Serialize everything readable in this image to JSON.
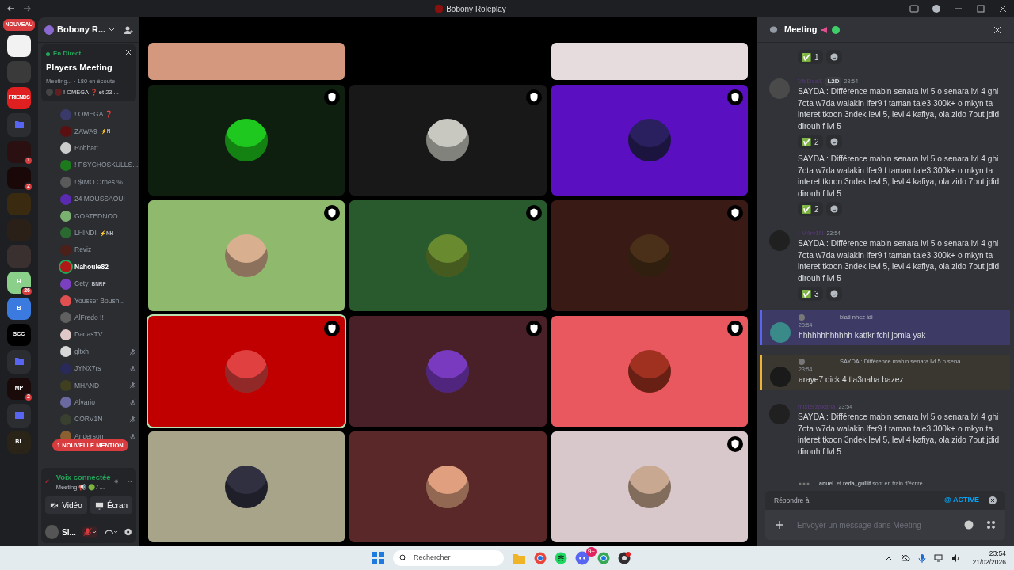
{
  "window": {
    "title": "Bobony Roleplay"
  },
  "servers": [
    {
      "kind": "new",
      "label": "NOUVEAU",
      "color": "#d83c3e"
    },
    {
      "kind": "icon",
      "color": "#f2f2f2"
    },
    {
      "kind": "icon",
      "color": "#3a3a3a"
    },
    {
      "kind": "icon",
      "color": "#e02020",
      "label": "FRIENDS"
    },
    {
      "kind": "folder",
      "color": "#5865f2"
    },
    {
      "kind": "icon",
      "color": "#2a1010",
      "badge": "1"
    },
    {
      "kind": "icon",
      "color": "#1a0808",
      "badge": "2"
    },
    {
      "kind": "icon",
      "color": "#3a2a10"
    },
    {
      "kind": "icon",
      "color": "#2a2018"
    },
    {
      "kind": "icon",
      "color": "#3a3030"
    },
    {
      "kind": "icon",
      "color": "#8ad08a",
      "label": "H",
      "badge": "26"
    },
    {
      "kind": "icon",
      "color": "#3b7be0",
      "label": "B"
    },
    {
      "kind": "icon",
      "color": "#000000",
      "label": "SCC"
    },
    {
      "kind": "folder",
      "color": "#5865f2"
    },
    {
      "kind": "icon",
      "color": "#1a0a0a",
      "label": "MP",
      "badge": "2"
    },
    {
      "kind": "folder",
      "color": "#5865f2"
    },
    {
      "kind": "icon",
      "color": "#2a2418",
      "label": "BL"
    }
  ],
  "server": {
    "name": "Bobony R..."
  },
  "live": {
    "status": "En Direct",
    "title": "Players Meeting",
    "info": "Meeting... · 180 en écoute",
    "participants": "! OMEGA ❓ et 23 ..."
  },
  "members": [
    {
      "name": "! OMEGA ❓",
      "color": "#3a3a6a",
      "muted": false,
      "speaking": false
    },
    {
      "name": "ZAWA9",
      "tag": "⚡N",
      "color": "#5a1010",
      "muted": false,
      "speaking": false
    },
    {
      "name": "Robbatt",
      "color": "#cccccc",
      "muted": false,
      "speaking": false
    },
    {
      "name": "! PSYCHOSKULLS...",
      "color": "#1c7a1c",
      "muted": false,
      "speaking": false
    },
    {
      "name": "! $IMO Ornes %",
      "color": "#5a5a5a",
      "muted": false,
      "speaking": false
    },
    {
      "name": "24 MOUSSAOUI",
      "color": "#5a2ab0",
      "muted": false,
      "speaking": false
    },
    {
      "name": "GOATEDNOO...",
      "color": "#7ab070",
      "muted": false,
      "speaking": false
    },
    {
      "name": "LHINDI",
      "tag": "⚡NH",
      "color": "#2a6a30",
      "muted": false,
      "speaking": false
    },
    {
      "name": "Reviz",
      "color": "#4a2018",
      "muted": false,
      "speaking": false
    },
    {
      "name": "Nahoule82",
      "color": "#b01818",
      "muted": false,
      "speaking": true
    },
    {
      "name": "Cety",
      "tag": "BNRP",
      "color": "#7a40c0",
      "muted": false,
      "speaking": false
    },
    {
      "name": "Youssef Boush...",
      "color": "#e05050",
      "muted": false,
      "speaking": false
    },
    {
      "name": "AlFredo !!",
      "color": "#606060",
      "muted": false,
      "speaking": false
    },
    {
      "name": "DanasTV",
      "color": "#e0c8c8",
      "muted": false,
      "speaking": false
    },
    {
      "name": "gltxh",
      "color": "#d8d8d8",
      "muted": true,
      "speaking": false
    },
    {
      "name": "JYNX7rs",
      "color": "#2a2a5a",
      "muted": true,
      "speaking": false
    },
    {
      "name": "MHAND",
      "color": "#404020",
      "muted": true,
      "speaking": false
    },
    {
      "name": "Alvario",
      "color": "#6a6aa0",
      "muted": true,
      "speaking": false
    },
    {
      "name": "CORV1N",
      "color": "#3a4030",
      "muted": true,
      "speaking": false
    },
    {
      "name": "Anderson",
      "color": "#8a6030",
      "muted": true,
      "speaking": false
    }
  ],
  "mention_pill": "1 NOUVELLE MENTION",
  "voice": {
    "status": "Voix connectée",
    "channel": "Meeting 📢 🟢 / ...",
    "video": "Vidéo",
    "screen": "Écran"
  },
  "user": {
    "name": "Sl...",
    "mic_muted": true
  },
  "tiles": [
    {
      "kind": "partial",
      "color": "#d4987f"
    },
    {
      "kind": "empty"
    },
    {
      "kind": "partial",
      "color": "#e6dcde"
    },
    {
      "kind": "participant",
      "color": "#0e1f10",
      "speaking": false,
      "badge": true
    },
    {
      "kind": "participant",
      "color": "#181818",
      "speaking": false,
      "badge": true
    },
    {
      "kind": "participant",
      "color": "#5a0fc0",
      "speaking": false,
      "badge": true
    },
    {
      "kind": "participant",
      "color": "#8fba6e",
      "speaking": false,
      "badge": true
    },
    {
      "kind": "participant",
      "color": "#285a2e",
      "speaking": false,
      "badge": true
    },
    {
      "kind": "participant",
      "color": "#3a1a14",
      "speaking": false,
      "badge": true
    },
    {
      "kind": "participant",
      "color": "#c00000",
      "speaking": true,
      "badge": true
    },
    {
      "kind": "participant",
      "color": "#4a2028",
      "speaking": false,
      "badge": true
    },
    {
      "kind": "participant",
      "color": "#e8585e",
      "speaking": false,
      "badge": true
    },
    {
      "kind": "participant",
      "color": "#a8a48a",
      "speaking": false,
      "badge": false
    },
    {
      "kind": "participant",
      "color": "#5a2828",
      "speaking": false,
      "badge": false
    },
    {
      "kind": "participant",
      "color": "#d8c8cc",
      "speaking": false,
      "badge": true
    }
  ],
  "chat": {
    "title": "Meeting",
    "messages": [
      {
        "kind": "continuation",
        "reactions": [
          {
            "emoji": "✅",
            "count": "1"
          }
        ]
      },
      {
        "kind": "message",
        "author": "VibDoaX",
        "tag": "L2D",
        "time": "23:54",
        "text": "SAYDA : Différence mabin senara lvl 5 o senara lvl 4 ghi 7ota w7da walakin lfer9 f taman tale3 300k+ o mkyn ta interet tkoon 3ndek levl 5, levl 4 kafiya, ola zido 7out jdid dirouh f lvl 5",
        "reactions": [
          {
            "emoji": "✅",
            "count": "2"
          }
        ]
      },
      {
        "kind": "continuation",
        "text": "SAYDA : Différence mabin senara lvl 5 o senara lvl 4 ghi 7ota w7da walakin lfer9 f taman tale3 300k+ o mkyn ta interet tkoon 3ndek levl 5, levl 4 kafiya, ola zido 7out jdid dirouh f lvl 5",
        "reactions": [
          {
            "emoji": "✅",
            "count": "2"
          }
        ]
      },
      {
        "kind": "message",
        "author": "! M4rv1N",
        "time": "23:54",
        "text": "SAYDA : Différence mabin senara lvl 5 o senara lvl 4 ghi 7ota w7da walakin lfer9 f taman tale3 300k+ o mkyn ta interet tkoon 3ndek levl 5, levl 4 kafiya, ola zido 7out jdid dirouh f lvl 5",
        "reactions": [
          {
            "emoji": "✅",
            "count": "3"
          }
        ]
      },
      {
        "kind": "reply",
        "mentions_me": false,
        "reply_text": "blati nhez idi",
        "time": "23:54",
        "text": "hhhhhhhhhhhh katfkr fchi jomla yak"
      },
      {
        "kind": "reply",
        "mentions_me": true,
        "reply_text": "SAYDA : Différence mabin senara lvl 5 o sena...",
        "time": "23:54",
        "text": "araye7 dick 4 tla3naha bazez"
      },
      {
        "kind": "message",
        "author": "misterzakaria",
        "time": "23:54",
        "text": "SAYDA : Différence mabin senara lvl 5 o senara lvl 4 ghi 7ota w7da walakin lfer9 f taman tale3 300k+ o mkyn ta interet tkoon 3ndek levl 5, levl 4 kafiya, ola zido 7out jdid dirouh f lvl 5"
      }
    ],
    "typing": "**anuel.** et **reda_gullit** sont en train d'écrire...",
    "reply_bar": {
      "label": "Répondre à",
      "mention": "@ ACTIVÉ"
    },
    "placeholder": "Envoyer un message dans Meeting"
  },
  "taskbar": {
    "search": "Rechercher",
    "discord_badge": "9+",
    "time": "23:54",
    "date": "21/02/2026"
  }
}
